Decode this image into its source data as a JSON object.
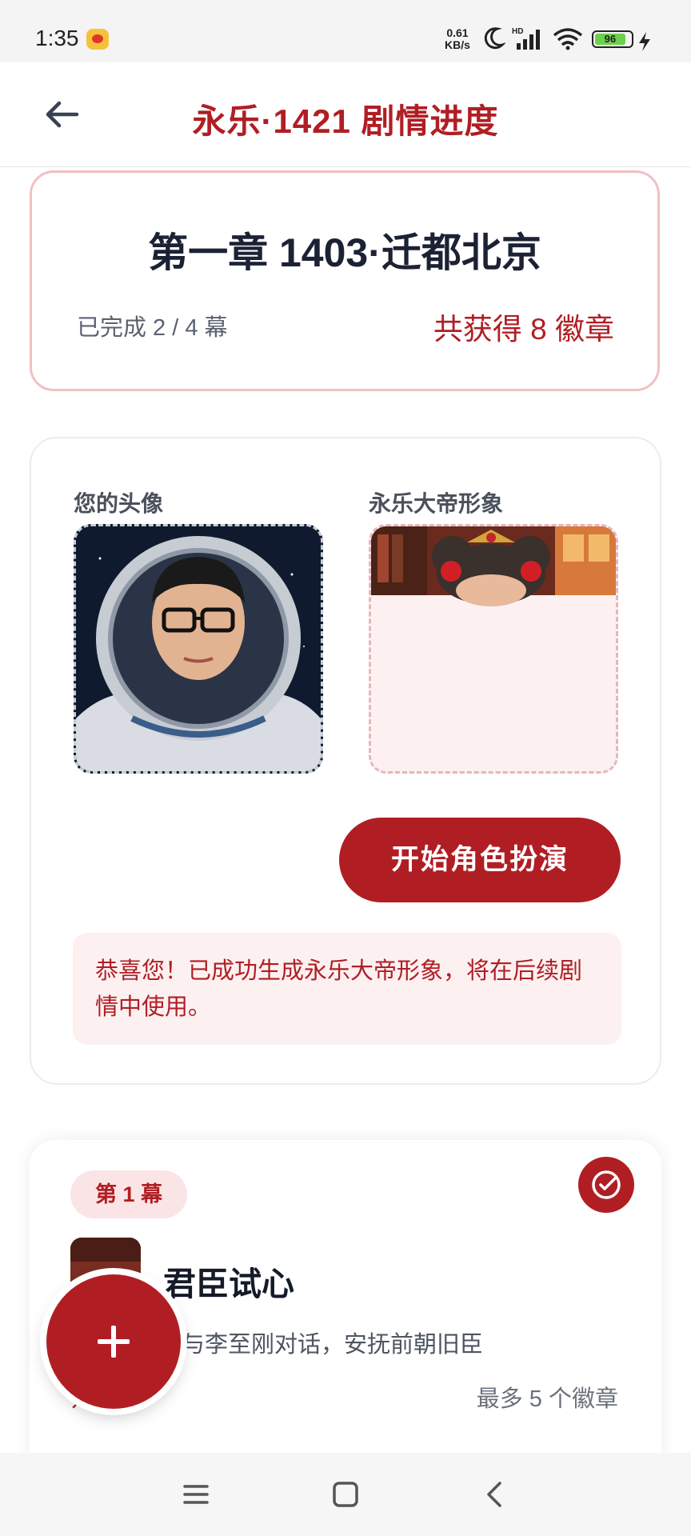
{
  "status_bar": {
    "time": "1:35",
    "net_speed_value": "0.61",
    "net_speed_unit": "KB/s",
    "battery": "96",
    "icons": [
      "weibo-icon",
      "moon-icon",
      "signal-icon",
      "wifi-icon",
      "battery-icon",
      "charging-icon"
    ]
  },
  "header": {
    "title": "永乐·1421 剧情进度",
    "back_icon": "arrow-left-icon"
  },
  "chapter": {
    "title": "第一章 1403·迁都北京",
    "progress": "已完成 2 / 4 幕",
    "badges": "共获得 8 徽章"
  },
  "avatars": {
    "user_label": "您的头像",
    "emperor_label": "永乐大帝形象",
    "start_button": "开始角色扮演",
    "success_message": "恭喜您！已成功生成永乐大帝形象，将在后续剧情中使用。"
  },
  "scene": {
    "tag": "第 1 幕",
    "title": "君臣试心",
    "description": "与李至刚对话，安抚前朝旧臣",
    "left_text": "对",
    "badges": "最多 5 个徽章",
    "status_icon": "check-circle-icon"
  },
  "fab": {
    "icon": "plus-icon"
  },
  "nav": {
    "icons": [
      "menu-icon",
      "home-square-icon",
      "back-chevron-icon"
    ]
  },
  "colors": {
    "accent": "#b01e24",
    "accent_light": "#fdf0f1",
    "border_pink": "#f1c0c3",
    "text_dark": "#1b2233"
  }
}
